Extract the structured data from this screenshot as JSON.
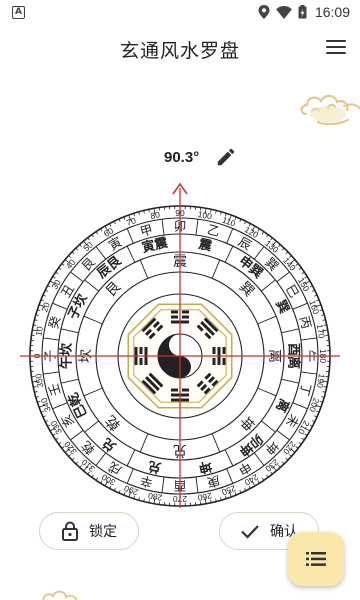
{
  "status_bar": {
    "left_icon": "A",
    "time": "16:09",
    "icons": [
      "location-icon",
      "wifi-icon",
      "battery-icon"
    ]
  },
  "app": {
    "title": "玄通风水罗盘"
  },
  "degree": {
    "value": "90.3°"
  },
  "compass": {
    "ring_mountains": [
      "子",
      "癸",
      "丑",
      "艮",
      "寅",
      "甲",
      "卯",
      "乙",
      "辰",
      "巽",
      "巳",
      "丙",
      "午",
      "丁",
      "未",
      "坤",
      "申",
      "庚",
      "酉",
      "辛",
      "戌",
      "乾",
      "亥",
      "壬"
    ],
    "ring_ganzhi": [
      "午坎",
      "子坎",
      "辰艮",
      "寅震",
      "震",
      "申巽",
      "巽",
      "酉离",
      "离",
      "卯坤",
      "坤",
      "兑",
      "兑",
      "巳乾"
    ],
    "ring_trigrams": [
      "坎",
      "艮",
      "震",
      "巽",
      "离",
      "坤",
      "兑",
      "乾"
    ],
    "degree_labels": [
      "0",
      "10",
      "20",
      "30",
      "40",
      "50",
      "60",
      "70",
      "80",
      "90",
      "100",
      "110",
      "120",
      "130",
      "140",
      "150",
      "160",
      "170",
      "180",
      "190",
      "200",
      "210",
      "220",
      "230",
      "240",
      "250",
      "260",
      "270",
      "280",
      "290",
      "300",
      "310",
      "320",
      "330",
      "340",
      "350"
    ],
    "colors": {
      "ring": "#222222",
      "crosshair": "#d32f2f",
      "bagua": "#222222"
    }
  },
  "buttons": {
    "lock": "锁定",
    "confirm": "确认"
  },
  "fab": {
    "icon": "list-icon"
  }
}
